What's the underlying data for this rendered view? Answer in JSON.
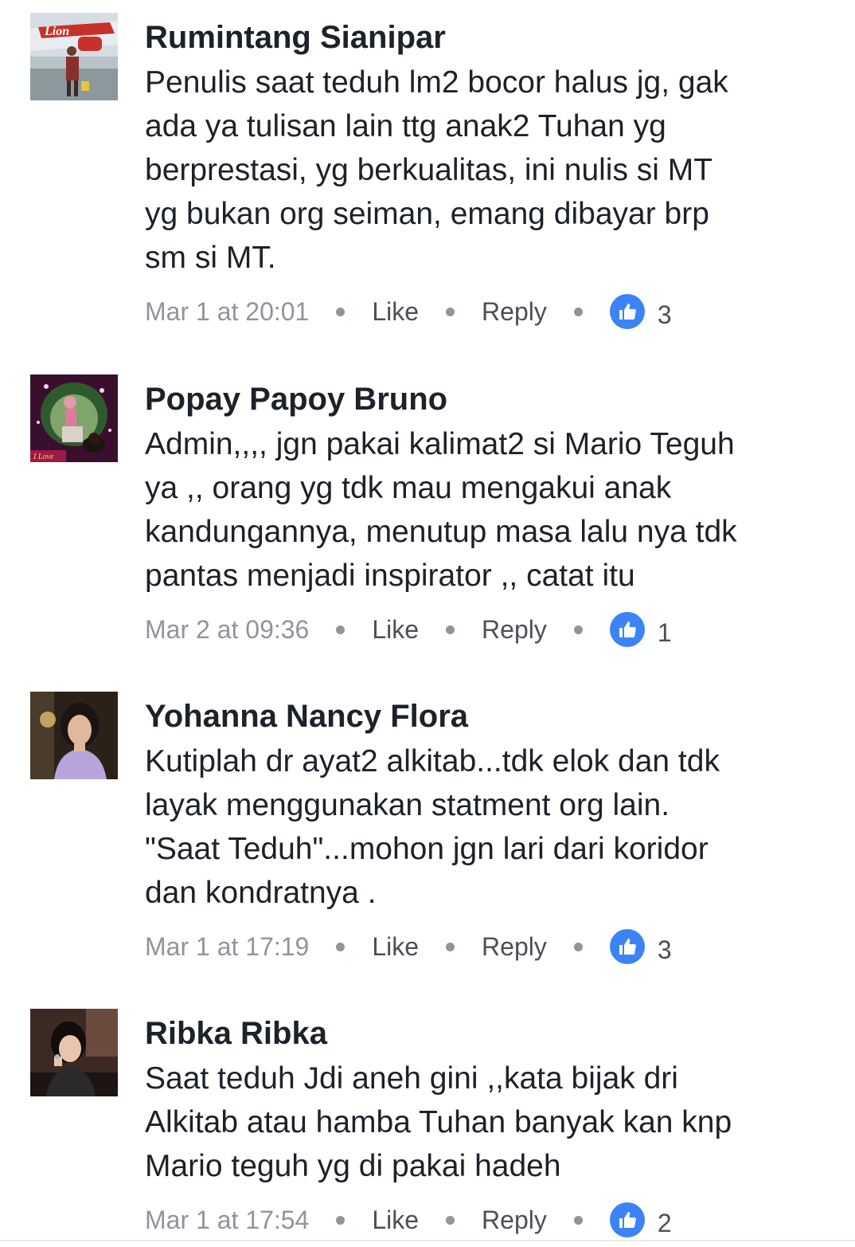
{
  "comments": [
    {
      "author": "Rumintang Sianipar",
      "lines": [
        "Penulis saat teduh lm2 bocor halus jg, gak",
        "ada ya tulisan lain ttg anak2 Tuhan yg",
        "berprestasi, yg berkualitas, ini nulis si MT",
        "yg bukan org seiman, emang dibayar brp",
        "sm si MT."
      ],
      "time": "Mar 1 at 20:01",
      "like_label": "Like",
      "reply_label": "Reply",
      "like_count": "3",
      "avatar_icon": "user-photo-icon"
    },
    {
      "author": "Popay Papoy Bruno",
      "lines": [
        "Admin,,,, jgn pakai kalimat2 si Mario Teguh",
        "ya ,, orang yg tdk mau mengakui anak",
        "kandungannya, menutup masa lalu nya tdk",
        "pantas menjadi inspirator ,, catat itu"
      ],
      "time": "Mar 2 at 09:36",
      "like_label": "Like",
      "reply_label": "Reply",
      "like_count": "1",
      "avatar_icon": "user-photo-icon"
    },
    {
      "author": "Yohanna Nancy Flora",
      "lines": [
        "Kutiplah dr ayat2 alkitab...tdk elok dan tdk",
        "layak menggunakan statment org lain.",
        "\"Saat Teduh\"...mohon jgn lari dari koridor",
        "dan kondratnya ."
      ],
      "time": "Mar 1 at 17:19",
      "like_label": "Like",
      "reply_label": "Reply",
      "like_count": "3",
      "avatar_icon": "user-photo-icon"
    },
    {
      "author": "Ribka Ribka",
      "lines": [
        "Saat teduh Jdi aneh gini ,,kata bijak dri",
        "Alkitab atau hamba Tuhan banyak kan knp",
        "Mario teguh yg di pakai hadeh"
      ],
      "time": "Mar 1 at 17:54",
      "like_label": "Like",
      "reply_label": "Reply",
      "like_count": "2",
      "avatar_icon": "user-photo-icon"
    }
  ],
  "colors": {
    "author": "#1d2129",
    "meta_gray": "#90949c",
    "action": "#4b4f56",
    "like_blue": "#3b83f7"
  },
  "avatar_logo_text": "Lion",
  "avatar_badge_text": "I Love"
}
